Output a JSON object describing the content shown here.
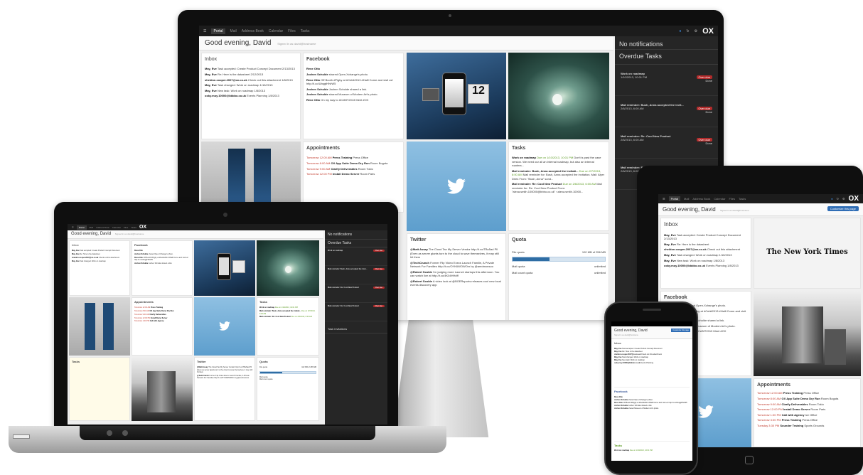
{
  "app": {
    "nav_items": [
      "Portal",
      "Mail",
      "Address Book",
      "Calendar",
      "Files",
      "Tasks"
    ],
    "logo": "OX",
    "greeting": "Good evening, David",
    "signed_in": "Signed in as david@hostname",
    "customize_button": "Customize this page"
  },
  "inbox": {
    "title": "Inbox",
    "items": [
      {
        "from": "May, Eve",
        "text": "Task accepted: Create Product Concept Document",
        "date": "2/13/2013"
      },
      {
        "from": "May, Eve",
        "text": "Re: Here is the datasheet",
        "date": "2/12/2013"
      },
      {
        "from": "sheldon.cooper.2007@ox.co.uk",
        "text": "Check out this attachment",
        "date": "1/8/2013"
      },
      {
        "from": "May, Eve",
        "text": "Task changed: Work on roadmap",
        "date": "1/10/2013"
      },
      {
        "from": "May, Eve",
        "text": "New task: Work on roadmap",
        "date": "1/8/2013"
      },
      {
        "from": "ooky.moy.10000@bbbbo.co.uk",
        "text": "Events Planning",
        "date": "1/8/2013"
      }
    ]
  },
  "facebook": {
    "title": "Facebook",
    "items": [
      {
        "from": "Rene Otto",
        "text": ""
      },
      {
        "from": "Jochen Schulde",
        "text": "shared Open-Xchange's photo."
      },
      {
        "from": "Rene Otto",
        "text": "Off Booth #Pigby at #Cebit2013 #Halll Come and visit us! http://t.co/UbqgtHNrW5"
      },
      {
        "from": "Jochen Schulde",
        "text": "Jochen Schulde shared a link."
      },
      {
        "from": "Jochen Schulde",
        "text": "shared Museum of Modern Art's photo."
      },
      {
        "from": "Rene Otto",
        "text": "On my way to #CeBIT2013 Meet #OX"
      }
    ]
  },
  "appointments": {
    "title": "Appointments",
    "items": [
      {
        "when": "Tomorrow 12:00 AM",
        "title": "Press Training",
        "where": "Press Office"
      },
      {
        "when": "Tomorrow 8:00 AM",
        "title": "OX App Suite Demo Dry Run",
        "where": "Room Bogota"
      },
      {
        "when": "Tomorrow 9:00 AM",
        "title": "Clarify Deliverables",
        "where": "Room Tokio"
      },
      {
        "when": "Tomorrow 12:00 PM",
        "title": "Install Demo Server",
        "where": "Room Paris"
      },
      {
        "when": "Tomorrow 1:00 PM",
        "title": "Call with Agency",
        "where": "Ice Office"
      },
      {
        "when": "Tomorrow 3:00 PM",
        "title": "Press Training",
        "where": "Press Office"
      },
      {
        "when": "Tuesday 3:30 PM",
        "title": "Sounder Training",
        "where": "Sports Grounds"
      }
    ]
  },
  "tasks": {
    "title": "Tasks",
    "items": [
      {
        "title": "Work on roadmap",
        "due": "Due on 1/10/2013, 10:01 PM",
        "text": "Don't is past the case version. We need our all an internal roadmap, but also an internal roadma..."
      },
      {
        "title": "Mail reminder: Bush, Anna accepted the invitati...",
        "due": "Due on 2/7/2013, 6:00 AM",
        "text": "Mail reminder for: Bush, Anna accepted the invitation. Mail: Alyer Dries From: \"Bush, Anna\" sond..."
      },
      {
        "title": "Mail reminder: Re: Cool New Product",
        "due": "Due on 2/6/2013, 6:00 AM",
        "text": "Mail reminder for: Re: Cool New Product From: \"alexa.smith.100000@bbbo.co.uk\" <alexa.smith.10000..."
      }
    ]
  },
  "twitter": {
    "title": "Twitter",
    "items": [
      {
        "from": "@Matt Assay",
        "text": "The Cloud Tax My Server Vendor http://t.co/TBu5ad Pll (Even as server giants turn to the cloud to save themselves, it may still hit them"
      },
      {
        "from": "@TechCrunch",
        "text": "Former Flip Video Execs Launch Familie, A Private Network For Families http://t.co/OYK6WOWOrx by @aredmonsoo"
      },
      {
        "from": "@Robert Scoble",
        "text": "I'm judging more Launch startups this afternoon. You can watch live at http://t.co/4K04HHdff"
      },
      {
        "from": "@Robert Scoble",
        "text": "A video look at @BOERsports releases cool new local events discovery app"
      }
    ]
  },
  "quota": {
    "title": "Quota",
    "rows": [
      {
        "label": "File quota",
        "value": "102 MB of 256 MB",
        "fraction": 0.4
      },
      {
        "label": "Mail quota",
        "value": "unlimited"
      },
      {
        "label": "Mail count quota",
        "value": "unlimited"
      }
    ]
  },
  "notifications": {
    "no_notifications": "No notifications",
    "overdue_title": "Overdue Tasks",
    "items": [
      {
        "title": "Work on roadmap",
        "date": "1/10/2013, 10:01 PM",
        "badge": "Over due",
        "action": "Done"
      },
      {
        "title": "Mail reminder: Bush, Anna accepted the invit...",
        "date": "2/6/2013, 6:00 AM",
        "badge": "Over due",
        "action": "Done"
      },
      {
        "title": "Mail reminder: Re: Cool New Product",
        "date": "2/6/2013, 6:00 AM",
        "badge": "Over due",
        "action": "Done"
      },
      {
        "title": "Mail reminder: Re: Cool New Product",
        "date": "2/6/2013, 6:00 AM",
        "badge": "Over due",
        "action": "Done"
      }
    ],
    "task_invitations": "Task invitations"
  },
  "new_york_times": "The New York Times",
  "colors": {
    "appointments": "#c0392b",
    "facebook": "#3b5998",
    "tasks": "#5a9a20",
    "twitter": "#2a9fd6",
    "badge": "#b32b2b"
  }
}
